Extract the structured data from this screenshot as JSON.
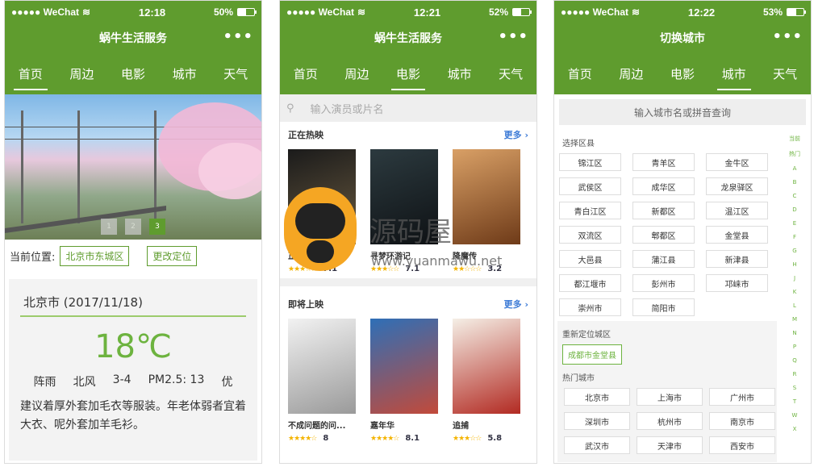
{
  "status": {
    "carrier": "●●●●● WeChat",
    "wifi_icon": "wifi-icon",
    "phones": [
      {
        "time": "12:18",
        "battery": "50%",
        "battery_level": 0.5
      },
      {
        "time": "12:21",
        "battery": "52%",
        "battery_level": 0.52
      },
      {
        "time": "12:22",
        "battery": "53%",
        "battery_level": 0.53
      }
    ]
  },
  "phone1": {
    "title": "蜗牛生活服务",
    "more_dots": "•••",
    "tabs": [
      "首页",
      "周边",
      "电影",
      "城市",
      "天气"
    ],
    "active_tab": 0,
    "banner_pages": [
      "1",
      "2",
      "3"
    ],
    "location_label": "当前位置:",
    "location_value": "北京市东城区",
    "relocate_button": "更改定位",
    "weather": {
      "date": "北京市 (2017/11/18)",
      "temp": "18℃",
      "cond": "阵雨",
      "wind": "北风",
      "level": "3-4",
      "pm": "PM2.5: 13",
      "quality": "优",
      "advice": "建议着厚外套加毛衣等服装。年老体弱者宜着大衣、呢外套加羊毛衫。"
    }
  },
  "phone2": {
    "title": "蜗牛生活服务",
    "more_dots": "•••",
    "tabs": [
      "首页",
      "周边",
      "电影",
      "城市",
      "天气"
    ],
    "active_tab": 2,
    "search_placeholder": "输入演员或片名",
    "now_showing": {
      "title": "正在热映",
      "more": "更多 ›",
      "movies": [
        {
          "name": "正义联盟",
          "stars": "★★★☆☆",
          "score": "7.1",
          "color": "#3a3a3a"
        },
        {
          "name": "寻梦环游记",
          "stars": "★★★☆☆",
          "score": "7.1",
          "color": "#2c3a3f"
        },
        {
          "name": "降魔传",
          "stars": "★★☆☆☆",
          "score": "3.2",
          "color": "#a46532"
        }
      ]
    },
    "coming_soon": {
      "title": "即将上映",
      "more": "更多 ›",
      "movies": [
        {
          "name": "不成问题的问...",
          "stars": "★★★★☆",
          "score": "8",
          "color": "#d9d9d9"
        },
        {
          "name": "嘉年华",
          "stars": "★★★★☆",
          "score": "8.1",
          "color": "#2e6fb7"
        },
        {
          "name": "追捕",
          "stars": "★★★☆☆",
          "score": "5.8",
          "color": "#e8e3dc"
        }
      ]
    }
  },
  "phone3": {
    "title": "切换城市",
    "more_dots": "•••",
    "tabs": [
      "首页",
      "周边",
      "电影",
      "城市",
      "天气"
    ],
    "active_tab": 3,
    "search_placeholder": "输入城市名或拼音查询",
    "district_label": "选择区县",
    "districts": [
      "锦江区",
      "青羊区",
      "金牛区",
      "武侯区",
      "成华区",
      "龙泉驿区",
      "青白江区",
      "新都区",
      "温江区",
      "双流区",
      "郫都区",
      "金堂县",
      "大邑县",
      "蒲江县",
      "新津县",
      "都江堰市",
      "彭州市",
      "邛崃市",
      "崇州市",
      "简阳市"
    ],
    "relocate_label": "重新定位城区",
    "relocate_value": "成都市金堂县",
    "hot_label": "热门城市",
    "hot_cities": [
      "北京市",
      "上海市",
      "广州市",
      "深圳市",
      "杭州市",
      "南京市",
      "武汉市",
      "天津市",
      "西安市"
    ],
    "index": [
      "当前",
      "热门",
      "A",
      "B",
      "C",
      "D",
      "E",
      "F",
      "G",
      "H",
      "J",
      "K",
      "L",
      "M",
      "N",
      "P",
      "Q",
      "R",
      "S",
      "T",
      "W",
      "X"
    ]
  },
  "watermark": {
    "text": "源码屋",
    "url": "www.yuanmawu.net"
  },
  "colors": {
    "primary": "#5f9c2e",
    "accent": "#6db33f",
    "link": "#3d7bd6"
  }
}
